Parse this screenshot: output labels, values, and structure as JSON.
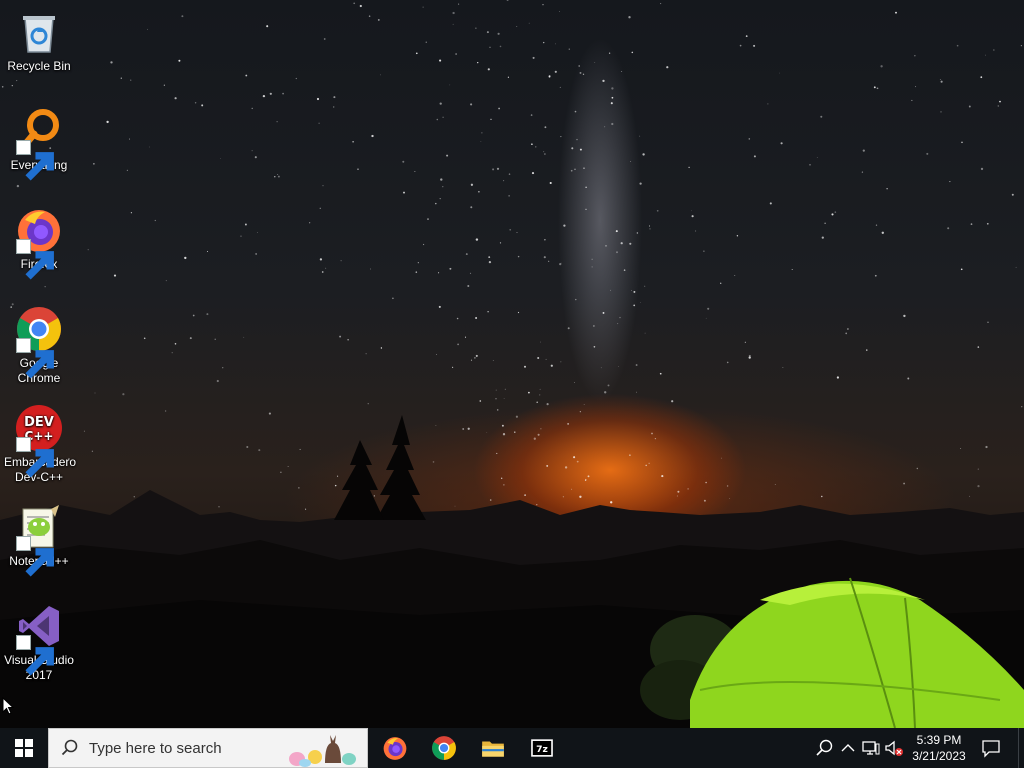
{
  "desktop": {
    "icons": [
      {
        "label": "Recycle Bin",
        "icon": "recycle-bin-icon"
      },
      {
        "label": "Everything",
        "icon": "everything-magnifier-icon"
      },
      {
        "label": "Firefox",
        "icon": "firefox-icon"
      },
      {
        "label": "Google Chrome",
        "icon": "chrome-icon"
      },
      {
        "label": "Embarcadero Dev-C++",
        "icon": "devcpp-icon",
        "badge": "DEV\nC++"
      },
      {
        "label": "Notepad++",
        "icon": "notepadpp-icon"
      },
      {
        "label": "Visual Studio 2017",
        "icon": "visual-studio-icon"
      }
    ]
  },
  "taskbar": {
    "search_placeholder": "Type here to search",
    "pinned_apps": [
      {
        "name": "Firefox",
        "icon": "firefox-icon"
      },
      {
        "name": "Google Chrome",
        "icon": "chrome-icon"
      },
      {
        "name": "File Explorer",
        "icon": "folder-icon"
      },
      {
        "name": "7-Zip",
        "icon": "7zip-icon",
        "text": "7z"
      }
    ],
    "tray": {
      "icons": [
        "search-icon",
        "chevron-up-icon",
        "network-icon",
        "volume-muted-icon"
      ]
    },
    "clock": {
      "time": "5:39 PM",
      "date": "3/21/2023"
    }
  },
  "colors": {
    "taskbar_bg": "#101418",
    "search_bg": "#f3f3f3",
    "accent": "#76b9ed",
    "tent_green": "#8fd61e"
  }
}
